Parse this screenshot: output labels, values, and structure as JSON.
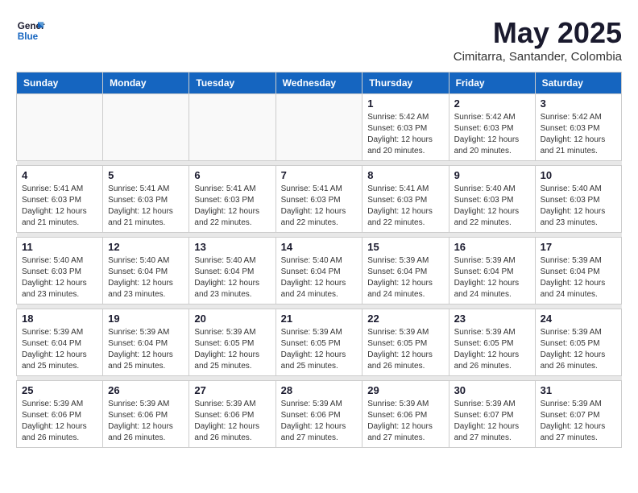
{
  "logo": {
    "line1": "General",
    "line2": "Blue"
  },
  "title": "May 2025",
  "subtitle": "Cimitarra, Santander, Colombia",
  "days_of_week": [
    "Sunday",
    "Monday",
    "Tuesday",
    "Wednesday",
    "Thursday",
    "Friday",
    "Saturday"
  ],
  "weeks": [
    [
      {
        "num": "",
        "info": ""
      },
      {
        "num": "",
        "info": ""
      },
      {
        "num": "",
        "info": ""
      },
      {
        "num": "",
        "info": ""
      },
      {
        "num": "1",
        "info": "Sunrise: 5:42 AM\nSunset: 6:03 PM\nDaylight: 12 hours\nand 20 minutes."
      },
      {
        "num": "2",
        "info": "Sunrise: 5:42 AM\nSunset: 6:03 PM\nDaylight: 12 hours\nand 20 minutes."
      },
      {
        "num": "3",
        "info": "Sunrise: 5:42 AM\nSunset: 6:03 PM\nDaylight: 12 hours\nand 21 minutes."
      }
    ],
    [
      {
        "num": "4",
        "info": "Sunrise: 5:41 AM\nSunset: 6:03 PM\nDaylight: 12 hours\nand 21 minutes."
      },
      {
        "num": "5",
        "info": "Sunrise: 5:41 AM\nSunset: 6:03 PM\nDaylight: 12 hours\nand 21 minutes."
      },
      {
        "num": "6",
        "info": "Sunrise: 5:41 AM\nSunset: 6:03 PM\nDaylight: 12 hours\nand 22 minutes."
      },
      {
        "num": "7",
        "info": "Sunrise: 5:41 AM\nSunset: 6:03 PM\nDaylight: 12 hours\nand 22 minutes."
      },
      {
        "num": "8",
        "info": "Sunrise: 5:41 AM\nSunset: 6:03 PM\nDaylight: 12 hours\nand 22 minutes."
      },
      {
        "num": "9",
        "info": "Sunrise: 5:40 AM\nSunset: 6:03 PM\nDaylight: 12 hours\nand 22 minutes."
      },
      {
        "num": "10",
        "info": "Sunrise: 5:40 AM\nSunset: 6:03 PM\nDaylight: 12 hours\nand 23 minutes."
      }
    ],
    [
      {
        "num": "11",
        "info": "Sunrise: 5:40 AM\nSunset: 6:03 PM\nDaylight: 12 hours\nand 23 minutes."
      },
      {
        "num": "12",
        "info": "Sunrise: 5:40 AM\nSunset: 6:04 PM\nDaylight: 12 hours\nand 23 minutes."
      },
      {
        "num": "13",
        "info": "Sunrise: 5:40 AM\nSunset: 6:04 PM\nDaylight: 12 hours\nand 23 minutes."
      },
      {
        "num": "14",
        "info": "Sunrise: 5:40 AM\nSunset: 6:04 PM\nDaylight: 12 hours\nand 24 minutes."
      },
      {
        "num": "15",
        "info": "Sunrise: 5:39 AM\nSunset: 6:04 PM\nDaylight: 12 hours\nand 24 minutes."
      },
      {
        "num": "16",
        "info": "Sunrise: 5:39 AM\nSunset: 6:04 PM\nDaylight: 12 hours\nand 24 minutes."
      },
      {
        "num": "17",
        "info": "Sunrise: 5:39 AM\nSunset: 6:04 PM\nDaylight: 12 hours\nand 24 minutes."
      }
    ],
    [
      {
        "num": "18",
        "info": "Sunrise: 5:39 AM\nSunset: 6:04 PM\nDaylight: 12 hours\nand 25 minutes."
      },
      {
        "num": "19",
        "info": "Sunrise: 5:39 AM\nSunset: 6:04 PM\nDaylight: 12 hours\nand 25 minutes."
      },
      {
        "num": "20",
        "info": "Sunrise: 5:39 AM\nSunset: 6:05 PM\nDaylight: 12 hours\nand 25 minutes."
      },
      {
        "num": "21",
        "info": "Sunrise: 5:39 AM\nSunset: 6:05 PM\nDaylight: 12 hours\nand 25 minutes."
      },
      {
        "num": "22",
        "info": "Sunrise: 5:39 AM\nSunset: 6:05 PM\nDaylight: 12 hours\nand 26 minutes."
      },
      {
        "num": "23",
        "info": "Sunrise: 5:39 AM\nSunset: 6:05 PM\nDaylight: 12 hours\nand 26 minutes."
      },
      {
        "num": "24",
        "info": "Sunrise: 5:39 AM\nSunset: 6:05 PM\nDaylight: 12 hours\nand 26 minutes."
      }
    ],
    [
      {
        "num": "25",
        "info": "Sunrise: 5:39 AM\nSunset: 6:06 PM\nDaylight: 12 hours\nand 26 minutes."
      },
      {
        "num": "26",
        "info": "Sunrise: 5:39 AM\nSunset: 6:06 PM\nDaylight: 12 hours\nand 26 minutes."
      },
      {
        "num": "27",
        "info": "Sunrise: 5:39 AM\nSunset: 6:06 PM\nDaylight: 12 hours\nand 26 minutes."
      },
      {
        "num": "28",
        "info": "Sunrise: 5:39 AM\nSunset: 6:06 PM\nDaylight: 12 hours\nand 27 minutes."
      },
      {
        "num": "29",
        "info": "Sunrise: 5:39 AM\nSunset: 6:06 PM\nDaylight: 12 hours\nand 27 minutes."
      },
      {
        "num": "30",
        "info": "Sunrise: 5:39 AM\nSunset: 6:07 PM\nDaylight: 12 hours\nand 27 minutes."
      },
      {
        "num": "31",
        "info": "Sunrise: 5:39 AM\nSunset: 6:07 PM\nDaylight: 12 hours\nand 27 minutes."
      }
    ]
  ]
}
